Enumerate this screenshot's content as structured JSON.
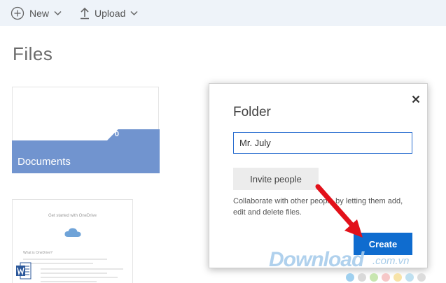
{
  "toolbar": {
    "new_label": "New",
    "upload_label": "Upload"
  },
  "page": {
    "title": "Files"
  },
  "files": [
    {
      "name": "Documents",
      "count": "0",
      "type": "folder"
    }
  ],
  "doc_preview": {
    "heading": "Get started with OneDrive",
    "subheading": "What is OneDrive?"
  },
  "dialog": {
    "title": "Folder",
    "name_value": "Mr. July",
    "invite_label": "Invite people",
    "description": "Collaborate with other people by letting them add, edit and delete files.",
    "create_label": "Create"
  },
  "watermark": {
    "brand": "Download",
    "tld": ".com.vn"
  },
  "colors": {
    "command_bar": "#eef3f9",
    "folder_band": "#7194cf",
    "primary_button": "#0f6ccf",
    "field_border": "#2b6fd0",
    "annotation_arrow": "#e2111a",
    "watermark": "#a8cdec"
  }
}
